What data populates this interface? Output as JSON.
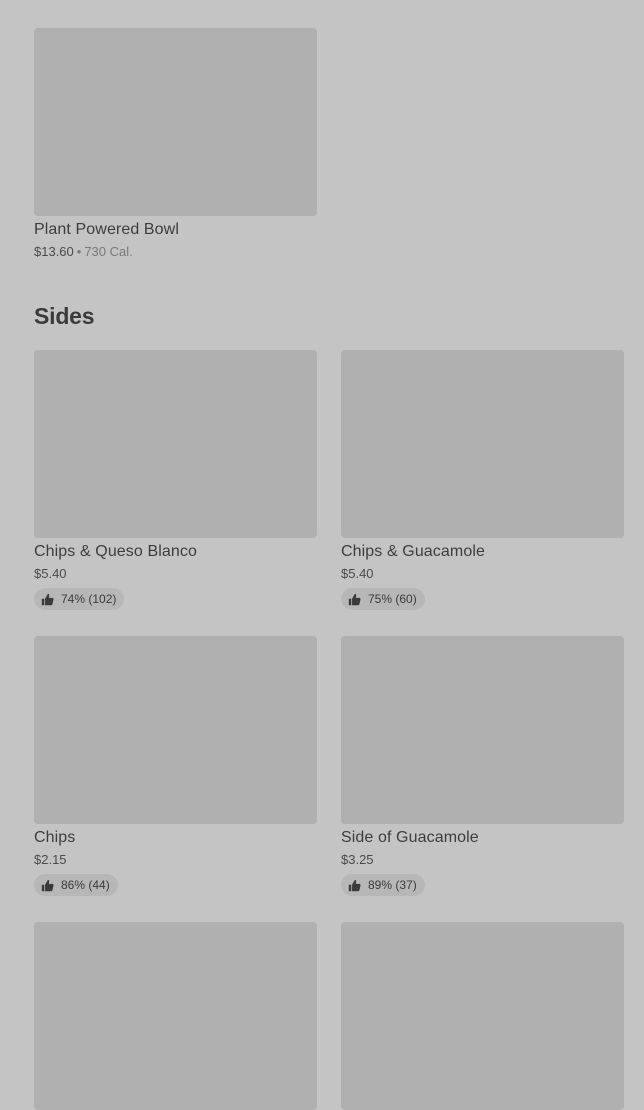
{
  "top_items": [
    {
      "name": "Plant Powered Bowl",
      "price": "$13.60",
      "separator": "•",
      "calories": "730 Cal."
    }
  ],
  "sides": {
    "title": "Sides",
    "items": [
      {
        "name": "Chips & Queso Blanco",
        "price": "$5.40",
        "rating": "74% (102)"
      },
      {
        "name": "Chips & Guacamole",
        "price": "$5.40",
        "rating": "75% (60)"
      },
      {
        "name": "Chips",
        "price": "$2.15",
        "rating": "86% (44)"
      },
      {
        "name": "Side of Guacamole",
        "price": "$3.25",
        "rating": "89% (37)"
      }
    ]
  },
  "icons": {
    "rating": "thumbs-up-icon"
  }
}
